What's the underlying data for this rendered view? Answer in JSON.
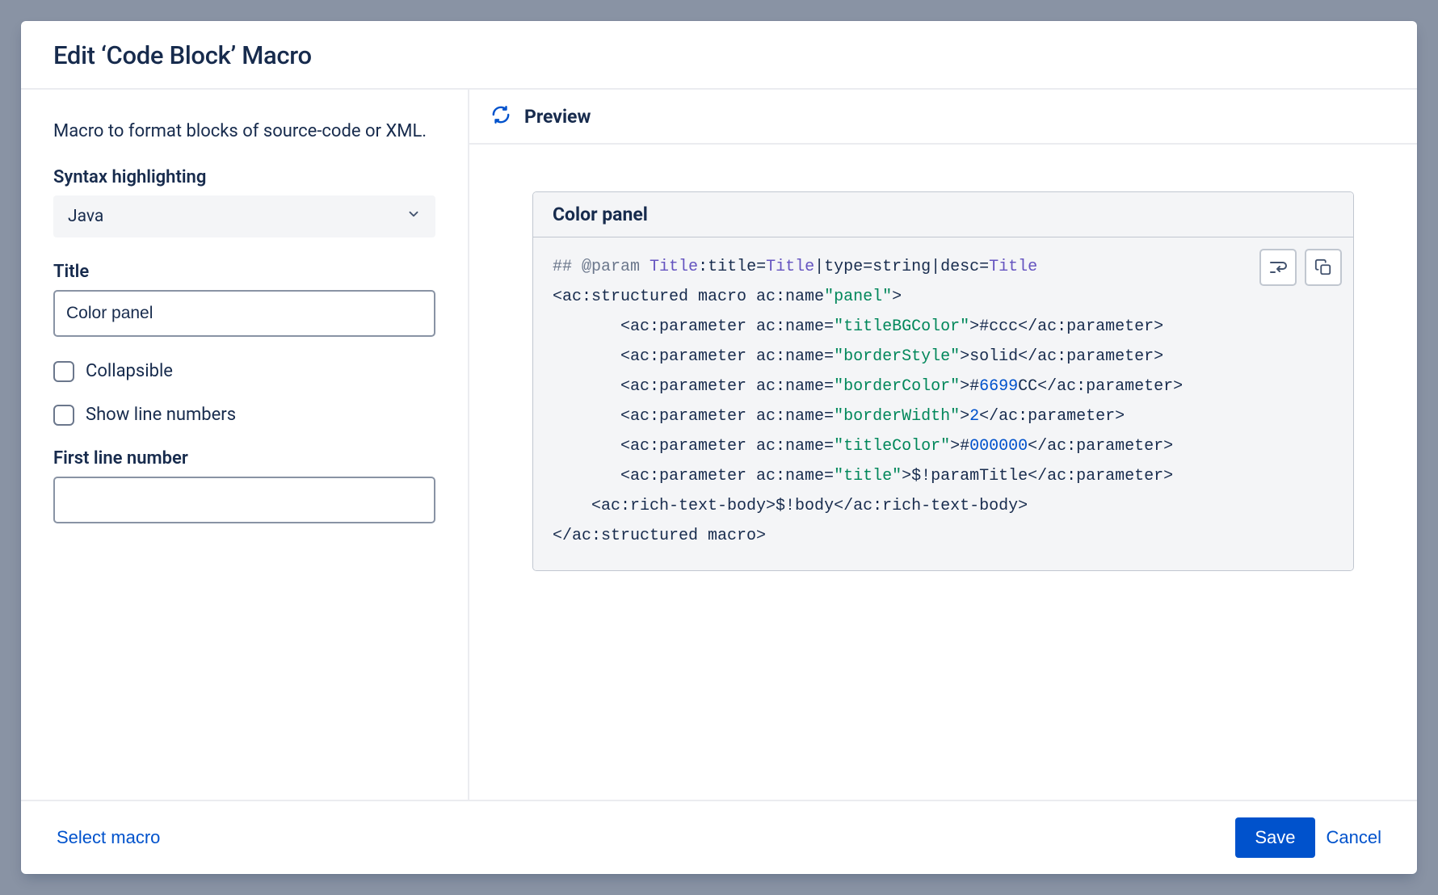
{
  "dialog": {
    "title": "Edit ‘Code Block’ Macro"
  },
  "sidebar": {
    "description": "Macro to format blocks of source-code or XML.",
    "syntax": {
      "label": "Syntax highlighting",
      "value": "Java"
    },
    "title_field": {
      "label": "Title",
      "value": "Color panel"
    },
    "collapsible": {
      "label": "Collapsible",
      "checked": false
    },
    "line_numbers": {
      "label": "Show line numbers",
      "checked": false
    },
    "first_line": {
      "label": "First line number",
      "value": ""
    }
  },
  "preview": {
    "header": "Preview",
    "panel_title": "Color panel",
    "code": {
      "l1": {
        "a": "## ",
        "b": "@param",
        "c": " ",
        "d": "Title",
        "e": ":title=",
        "f": "Title",
        "g": "|type=string|desc=",
        "h": "Title"
      },
      "l2": {
        "a": "<ac:structured macro ac:name",
        "b": "\"panel\"",
        "c": ">"
      },
      "l3": {
        "pad": "       ",
        "a": "<ac:parameter ac:name=",
        "b": "\"titleBGColor\"",
        "c": ">#ccc</ac:parameter>"
      },
      "l4": {
        "pad": "       ",
        "a": "<ac:parameter ac:name=",
        "b": "\"borderStyle\"",
        "c": ">solid</ac:parameter>"
      },
      "l5": {
        "pad": "       ",
        "a": "<ac:parameter ac:name=",
        "b": "\"borderColor\"",
        "c": ">#",
        "d": "6699",
        "e": "CC</ac:parameter>"
      },
      "l6": {
        "pad": "       ",
        "a": "<ac:parameter ac:name=",
        "b": "\"borderWidth\"",
        "c": ">",
        "d": "2",
        "e": "</ac:parameter>"
      },
      "l7": {
        "pad": "       ",
        "a": "<ac:parameter ac:name=",
        "b": "\"titleColor\"",
        "c": ">#",
        "d": "000000",
        "e": "</ac:parameter>"
      },
      "l8": {
        "pad": "       ",
        "a": "<ac:parameter ac:name=",
        "b": "\"title\"",
        "c": ">$!paramTitle</ac:parameter>"
      },
      "l9": {
        "pad": "    ",
        "a": "<ac:rich-text-body>$!body</ac:rich-text-body>"
      },
      "l10": {
        "a": "</ac:structured macro>"
      }
    }
  },
  "footer": {
    "select_macro": "Select macro",
    "save": "Save",
    "cancel": "Cancel"
  }
}
